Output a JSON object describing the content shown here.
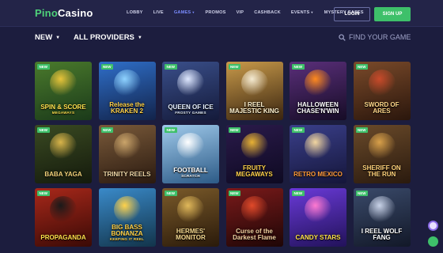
{
  "header": {
    "logo_part1": "Pino",
    "logo_part2": "Casino",
    "nav": [
      {
        "label": "LOBBY",
        "active": false,
        "has_caret": false
      },
      {
        "label": "LIVE",
        "active": false,
        "has_caret": false
      },
      {
        "label": "GAMES",
        "active": true,
        "has_caret": true
      },
      {
        "label": "PROMOS",
        "active": false,
        "has_caret": false
      },
      {
        "label": "VIP",
        "active": false,
        "has_caret": false
      },
      {
        "label": "CASHBACK",
        "active": false,
        "has_caret": false
      },
      {
        "label": "EVENTS",
        "active": false,
        "has_caret": true
      },
      {
        "label": "MYSTERY CASES",
        "active": false,
        "has_caret": false
      }
    ],
    "login_label": "LOGIN",
    "signup_label": "SIGN UP"
  },
  "filters": {
    "new_label": "NEW",
    "providers_label": "ALL PROVIDERS",
    "search_label": "FIND YOUR GAME"
  },
  "badge_label": "NEW",
  "games": [
    {
      "title": "SPIN & SCORE",
      "subtitle": "MEGAWAYS",
      "new": true,
      "bg": [
        "#4a7a2c",
        "#1b3a1a"
      ],
      "accent": "#e7c33a",
      "text": "#ffe14d"
    },
    {
      "title": "Release the KRAKEN 2",
      "subtitle": "",
      "new": true,
      "bg": [
        "#2f6fc9",
        "#12234a"
      ],
      "accent": "#8fd3ff",
      "text": "#ffd24a"
    },
    {
      "title": "QUEEN OF ICE",
      "subtitle": "FROSTY GAMES",
      "new": true,
      "bg": [
        "#3a4f8a",
        "#141a3a"
      ],
      "accent": "#dfe8ff",
      "text": "#e7f1ff"
    },
    {
      "title": "I REEL MAJESTIC KING",
      "subtitle": "",
      "new": true,
      "bg": [
        "#c89a4a",
        "#3a2510"
      ],
      "accent": "#f4ead2",
      "text": "#fff3d0"
    },
    {
      "title": "HALLOWEEN CHASE'N'WIN",
      "subtitle": "",
      "new": true,
      "bg": [
        "#5a2f7a",
        "#160c26"
      ],
      "accent": "#ff8a1e",
      "text": "#ffffff"
    },
    {
      "title": "SWORD OF ARES",
      "subtitle": "",
      "new": true,
      "bg": [
        "#7a4a2a",
        "#2a160c"
      ],
      "accent": "#c84a2a",
      "text": "#ffd88a"
    },
    {
      "title": "BABA YAGA",
      "subtitle": "",
      "new": true,
      "bg": [
        "#3a4a22",
        "#141a0c"
      ],
      "accent": "#d8b44a",
      "text": "#f2d27a"
    },
    {
      "title": "TRINITY REELS",
      "subtitle": "",
      "new": true,
      "bg": [
        "#7a5a3a",
        "#2a1a10"
      ],
      "accent": "#caa46a",
      "text": "#f0d8a8"
    },
    {
      "title": "FOOTBALL",
      "subtitle": "SCRATCH",
      "new": true,
      "bg": [
        "#9fc9ea",
        "#2c5a86"
      ],
      "accent": "#ffffff",
      "text": "#ffffff"
    },
    {
      "title": "FRUITY MEGAWAYS",
      "subtitle": "",
      "new": true,
      "bg": [
        "#2a1a4a",
        "#0e0a22"
      ],
      "accent": "#e8b234",
      "text": "#ffd24a"
    },
    {
      "title": "RETRO MEXICO",
      "subtitle": "",
      "new": true,
      "bg": [
        "#3a3f8a",
        "#15163a"
      ],
      "accent": "#f2d6a0",
      "text": "#ff9a3a"
    },
    {
      "title": "SHERIFF ON THE RUN",
      "subtitle": "",
      "new": true,
      "bg": [
        "#6a4a2a",
        "#2a1a0e"
      ],
      "accent": "#d8a04a",
      "text": "#ffd27a"
    },
    {
      "title": "PROPAGANDA",
      "subtitle": "",
      "new": true,
      "bg": [
        "#a8281a",
        "#3a0a06"
      ],
      "accent": "#1a1a1a",
      "text": "#ffe04a"
    },
    {
      "title": "BIG BASS BONANZA",
      "subtitle": "KEEPING IT REEL",
      "new": false,
      "bg": [
        "#3a8ac9",
        "#12344a"
      ],
      "accent": "#ffd24a",
      "text": "#ffd24a"
    },
    {
      "title": "HERMES' MONITOR",
      "subtitle": "",
      "new": true,
      "bg": [
        "#7a5a2a",
        "#2a1a0a"
      ],
      "accent": "#e0b85a",
      "text": "#f4d890"
    },
    {
      "title": "Curse of the Darkest Flame",
      "subtitle": "",
      "new": true,
      "bg": [
        "#7a1a1a",
        "#1e0606"
      ],
      "accent": "#e04a2a",
      "text": "#f4d0a0"
    },
    {
      "title": "CANDY STARS",
      "subtitle": "",
      "new": true,
      "bg": [
        "#6a3ad8",
        "#22125a"
      ],
      "accent": "#ff7ad0",
      "text": "#ffe24a"
    },
    {
      "title": "I REEL WOLF FANG",
      "subtitle": "",
      "new": true,
      "bg": [
        "#3a4a6a",
        "#121828"
      ],
      "accent": "#c9d3e8",
      "text": "#ffffff"
    }
  ],
  "colors": {
    "page_bg": "#1c1d3e",
    "header_bg": "#232448",
    "accent_green": "#3ec06a",
    "nav_active": "#7b8cff"
  },
  "icons": {
    "search": "search-icon",
    "caret": "chevron-down-icon",
    "chat": "chat-icon",
    "support": "support-icon"
  }
}
